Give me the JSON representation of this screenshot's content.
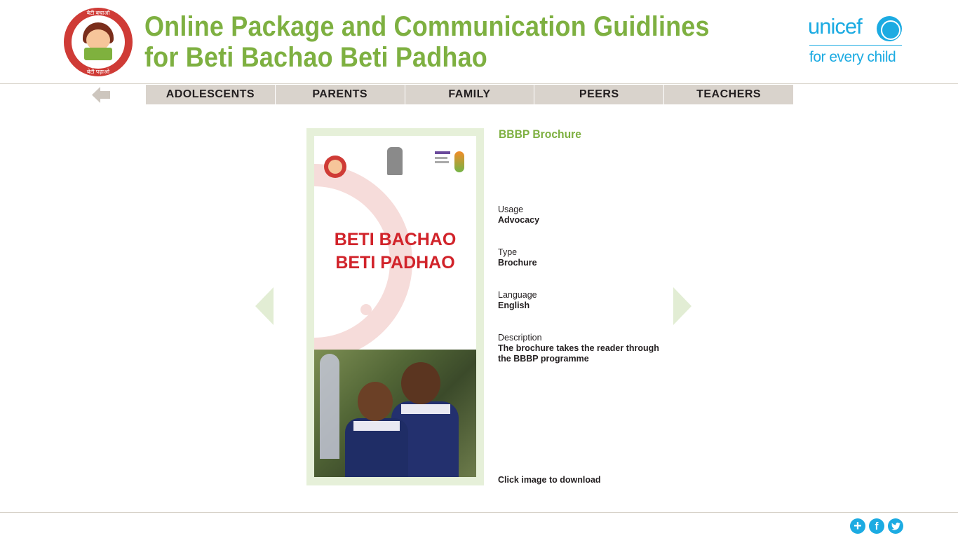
{
  "header": {
    "title_line1": "Online Package and Communication Guidlines",
    "title_line2": "for Beti Bachao Beti Padhao",
    "left_logo": {
      "icon": "bbbp-logo-icon",
      "ring_top": "बेटी बचाओ",
      "ring_bottom": "बेटी पढ़ाओ"
    },
    "right_logo": {
      "wordmark": "unicef",
      "tagline": "for every child",
      "icon": "unicef-globe-icon"
    }
  },
  "nav": {
    "back_icon": "arrow-left-icon",
    "items": [
      {
        "label": "ADOLESCENTS"
      },
      {
        "label": "PARENTS"
      },
      {
        "label": "FAMILY"
      },
      {
        "label": "PEERS"
      },
      {
        "label": "TEACHERS"
      }
    ]
  },
  "carousel": {
    "prev_icon": "triangle-left-icon",
    "next_icon": "triangle-right-icon"
  },
  "brochure": {
    "heading_line1": "BETI BACHAO",
    "heading_line2": "BETI PADHAO"
  },
  "info": {
    "title": "BBBP Brochure",
    "usage_label": "Usage",
    "usage_value": "Advocacy",
    "type_label": "Type",
    "type_value": "Brochure",
    "language_label": "Language",
    "language_value": "English",
    "description_label": "Description",
    "description_value": "The brochure takes the reader through the BBBP programme",
    "download_text": "Click image to download"
  },
  "footer": {
    "social": [
      {
        "icon": "plus-share-icon",
        "glyph": "+"
      },
      {
        "icon": "facebook-icon",
        "glyph": "f"
      },
      {
        "icon": "twitter-icon",
        "glyph": "t"
      }
    ]
  },
  "colors": {
    "brand_green": "#7eb041",
    "unicef_blue": "#1cabe2",
    "nav_bg": "#d9d3cc",
    "arrow_green_light": "#e6f0d9",
    "logo_red": "#cf3b36",
    "heading_red": "#d1232a"
  }
}
